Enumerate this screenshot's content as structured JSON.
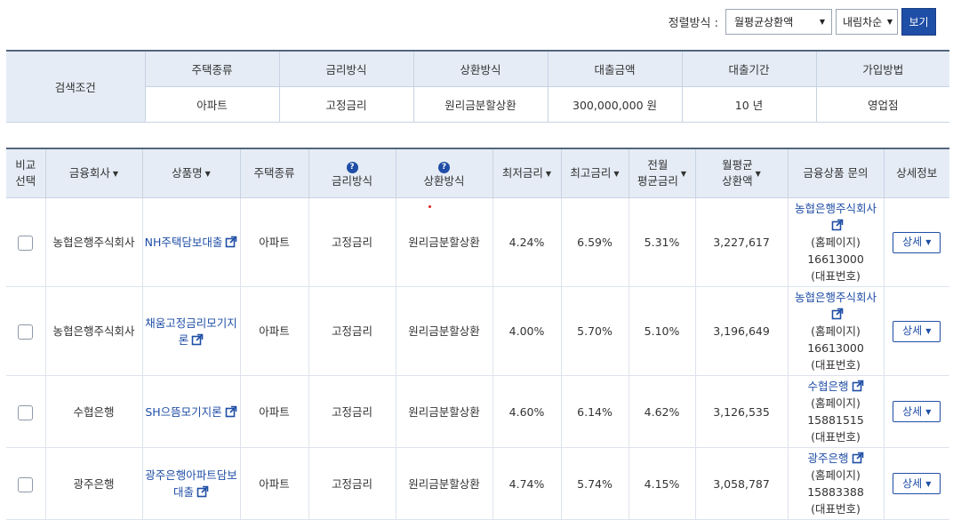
{
  "sort": {
    "label": "정렬방식 :",
    "sort_by": "월평균상환액",
    "order": "내림차순",
    "view_button": "보기"
  },
  "search": {
    "title": "검색조건",
    "headers": [
      "주택종류",
      "금리방식",
      "상환방식",
      "대출금액",
      "대출기간",
      "가입방법"
    ],
    "values": [
      "아파트",
      "고정금리",
      "원리금분할상환",
      "300,000,000 원",
      "10 년",
      "영업점"
    ]
  },
  "table": {
    "headers": {
      "select_line1": "비교",
      "select_line2": "선택",
      "company": "금융회사",
      "product": "상품명",
      "house_type": "주택종류",
      "rate_type": "금리방식",
      "repay_type": "상환방식",
      "min_rate": "최저금리",
      "max_rate": "최고금리",
      "avg_rate_line1": "전월",
      "avg_rate_line2": "평균금리",
      "monthly_line1": "월평균",
      "monthly_line2": "상환액",
      "inquiry": "금융상품 문의",
      "detail": "상세정보"
    },
    "help_glyph": "?",
    "sort_glyph": "▼",
    "rows": [
      {
        "company": "농협은행주식회사",
        "product": "NH주택담보대출",
        "house_type": "아파트",
        "rate_type": "고정금리",
        "repay_type": "원리금분할상환",
        "min_rate": "4.24%",
        "max_rate": "6.59%",
        "avg_rate": "5.31%",
        "monthly": "3,227,617",
        "inquiry_name": "농협은행주식회사",
        "homepage": "(홈페이지)",
        "phone": "16613000",
        "phone_label": "(대표번호)",
        "detail": "상세"
      },
      {
        "company": "농협은행주식회사",
        "product": "채움고정금리모기지론",
        "house_type": "아파트",
        "rate_type": "고정금리",
        "repay_type": "원리금분할상환",
        "min_rate": "4.00%",
        "max_rate": "5.70%",
        "avg_rate": "5.10%",
        "monthly": "3,196,649",
        "inquiry_name": "농협은행주식회사",
        "homepage": "(홈페이지)",
        "phone": "16613000",
        "phone_label": "(대표번호)",
        "detail": "상세"
      },
      {
        "company": "수협은행",
        "product": "SH으뜸모기지론",
        "house_type": "아파트",
        "rate_type": "고정금리",
        "repay_type": "원리금분할상환",
        "min_rate": "4.60%",
        "max_rate": "6.14%",
        "avg_rate": "4.62%",
        "monthly": "3,126,535",
        "inquiry_name": "수협은행",
        "homepage": "(홈페이지)",
        "phone": "15881515",
        "phone_label": "(대표번호)",
        "detail": "상세"
      },
      {
        "company": "광주은행",
        "product": "광주은행아파트담보대출",
        "house_type": "아파트",
        "rate_type": "고정금리",
        "repay_type": "원리금분할상환",
        "min_rate": "4.74%",
        "max_rate": "5.74%",
        "avg_rate": "4.15%",
        "monthly": "3,058,787",
        "inquiry_name": "광주은행",
        "homepage": "(홈페이지)",
        "phone": "15883388",
        "phone_label": "(대표번호)",
        "detail": "상세"
      }
    ]
  },
  "colors": {
    "accent": "#1f4ea6",
    "header_bg": "#e5ecf6",
    "border": "#c8d3e2"
  },
  "icons": [
    "external-link-icon",
    "help-icon",
    "sort-arrow-icon",
    "dropdown-caret-icon"
  ]
}
